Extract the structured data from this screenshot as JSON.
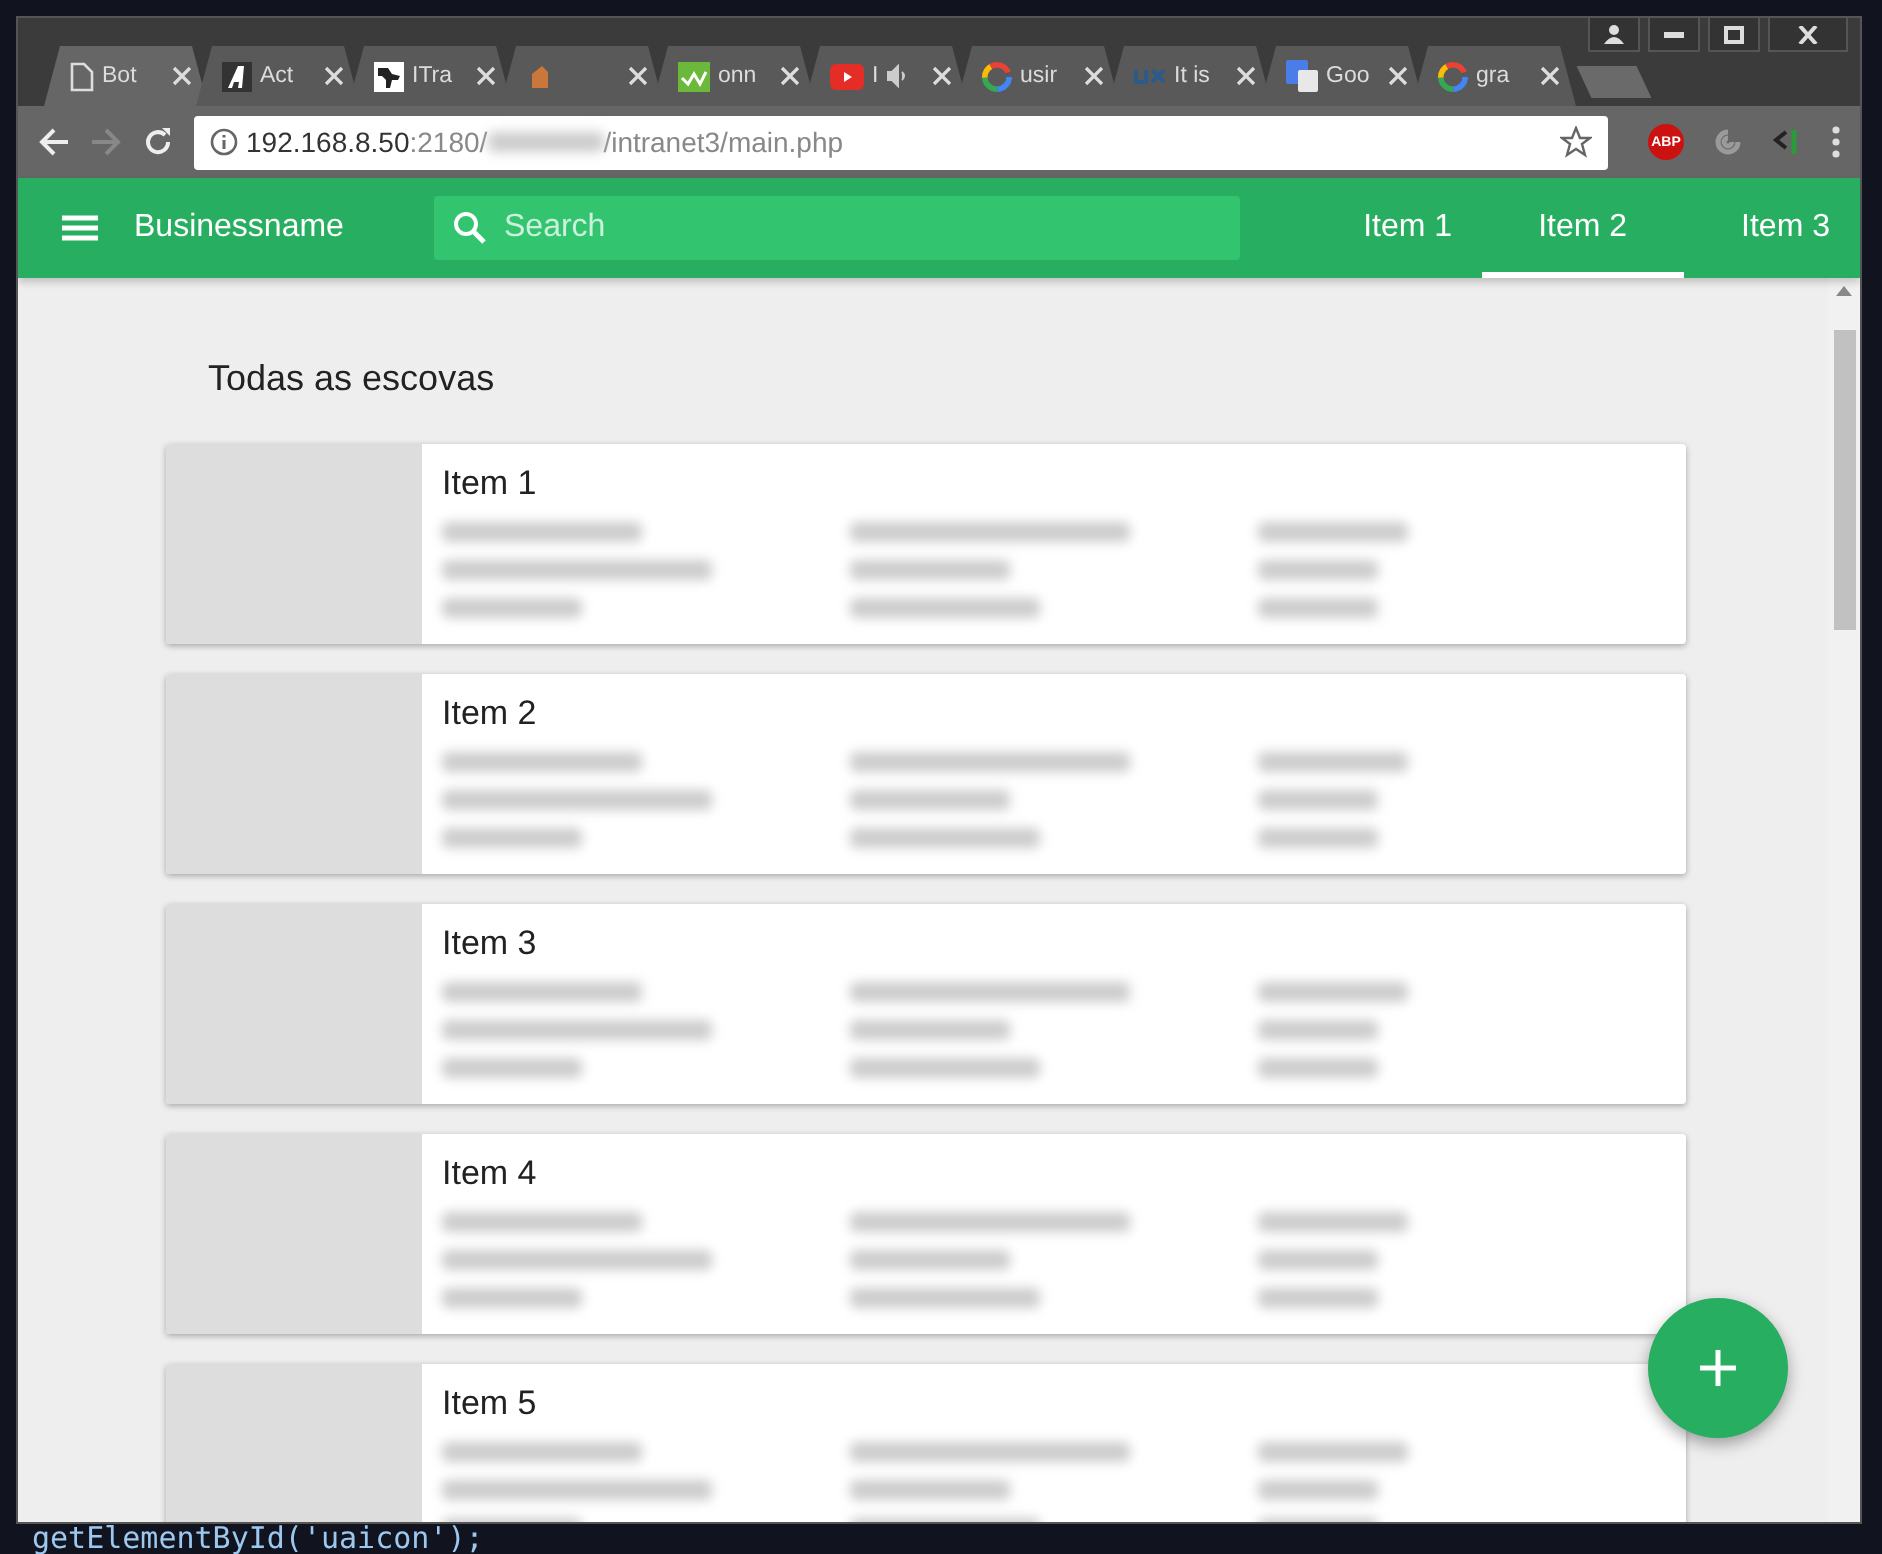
{
  "browser": {
    "tabs": [
      {
        "kind": "page",
        "title": "Bot",
        "audio": false,
        "selected": true
      },
      {
        "kind": "a-logo",
        "title": "Act",
        "audio": false,
        "selected": false
      },
      {
        "kind": "image",
        "title": "ITra",
        "audio": false,
        "selected": false
      },
      {
        "kind": "orange",
        "audio": false,
        "selected": false
      },
      {
        "kind": "w3",
        "title": "onn",
        "audio": false,
        "selected": false
      },
      {
        "kind": "youtube",
        "title": "I",
        "audio": true,
        "selected": false
      },
      {
        "kind": "google",
        "title": "usir",
        "audio": false,
        "selected": false
      },
      {
        "kind": "ux",
        "title": "It is",
        "audio": false,
        "selected": false
      },
      {
        "kind": "translate",
        "title": "Goo",
        "audio": false,
        "selected": false
      },
      {
        "kind": "google",
        "title": "gra",
        "audio": false,
        "selected": false
      }
    ],
    "address": {
      "host": "192.168.8.50",
      "port": ":2180/",
      "path": "/intranet3/main.php"
    },
    "extensions": [
      {
        "kind": "abp",
        "label": "ABP"
      },
      {
        "kind": "grey"
      },
      {
        "kind": "green"
      }
    ]
  },
  "app_bar": {
    "brand": "Businessname",
    "search": {
      "placeholder": "Search"
    },
    "nav": [
      {
        "label": "Item 1",
        "selected": false
      },
      {
        "label": "Item 2",
        "selected": true
      },
      {
        "label": "Item 3",
        "selected": false
      }
    ]
  },
  "heading": "Todas as escovas",
  "cards": [
    {
      "title": "Item 1"
    },
    {
      "title": "Item 2"
    },
    {
      "title": "Item 3"
    },
    {
      "title": "Item 4"
    },
    {
      "title": "Item 5"
    }
  ],
  "code_behind": "getElementById('uaicon');"
}
